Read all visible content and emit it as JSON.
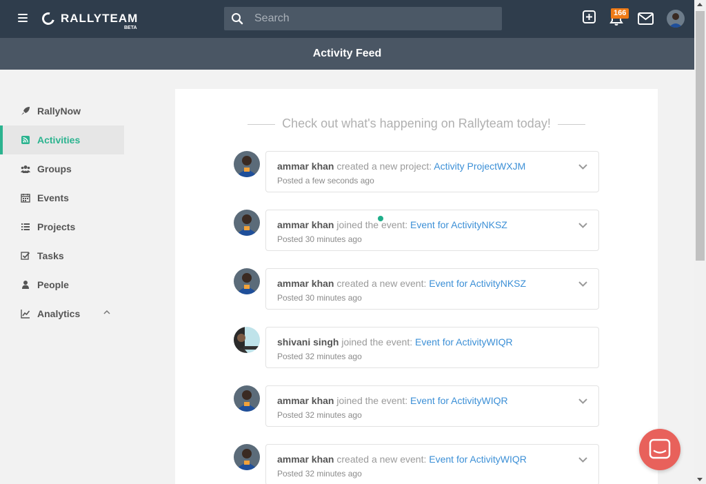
{
  "header": {
    "brand": "RALLYTEAM",
    "beta": "BETA",
    "search_placeholder": "Search",
    "notification_count": "166",
    "icons": [
      "hamburger-icon",
      "search-icon",
      "plus-square-icon",
      "bell-icon",
      "envelope-icon"
    ]
  },
  "page": {
    "title": "Activity Feed"
  },
  "sidebar": {
    "items": [
      {
        "label": "RallyNow",
        "icon": "rocket-icon"
      },
      {
        "label": "Activities",
        "icon": "rss-icon",
        "active": true
      },
      {
        "label": "Groups",
        "icon": "users-icon"
      },
      {
        "label": "Events",
        "icon": "calendar-icon"
      },
      {
        "label": "Projects",
        "icon": "list-icon"
      },
      {
        "label": "Tasks",
        "icon": "checkbox-icon"
      },
      {
        "label": "People",
        "icon": "user-icon"
      },
      {
        "label": "Analytics",
        "icon": "chart-icon"
      }
    ]
  },
  "feed": {
    "heading": "Check out what's happening on Rallyteam today!",
    "entries": [
      {
        "user": "ammar khan",
        "action": "created a new project:",
        "target": "Activity ProjectWXJM",
        "time": "Posted a few seconds ago"
      },
      {
        "user": "ammar khan",
        "action": "joined the event:",
        "target": "Event for ActivityNKSZ",
        "time": "Posted 30 minutes ago"
      },
      {
        "user": "ammar khan",
        "action": "created a new event:",
        "target": "Event for ActivityNKSZ",
        "time": "Posted 30 minutes ago"
      },
      {
        "user": "shivani singh",
        "action": "joined the event:",
        "target": "Event for ActivityWIQR",
        "time": "Posted 32 minutes ago"
      },
      {
        "user": "ammar khan",
        "action": "joined the event:",
        "target": "Event for ActivityWIQR",
        "time": "Posted 32 minutes ago"
      },
      {
        "user": "ammar khan",
        "action": "created a new event:",
        "target": "Event for ActivityWIQR",
        "time": "Posted 32 minutes ago"
      }
    ]
  },
  "colors": {
    "topbar": "#2f3d4c",
    "subheader": "#4a5664",
    "accent": "#2bb38f",
    "link": "#3b8fd6",
    "badge": "#f07b16",
    "chat": "#e8615b"
  }
}
